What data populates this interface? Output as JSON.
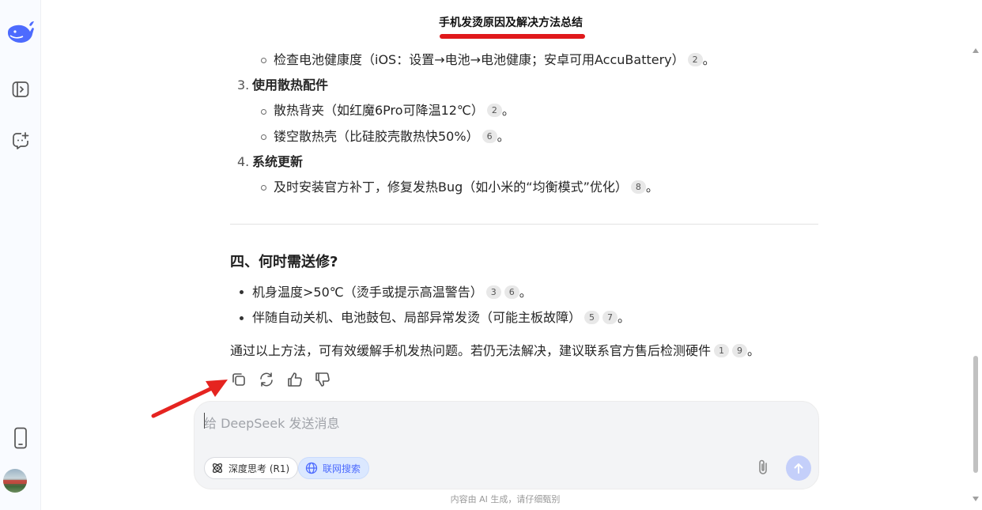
{
  "title": "手机发烫原因及解决方法总结",
  "colors": {
    "accent": "#4d6bfe",
    "underline": "#e0191b",
    "arrow": "#e52420"
  },
  "icons": {
    "logo": "deepseek-whale-icon",
    "sidebar": [
      "sidebar-toggle-icon",
      "new-chat-icon",
      "mobile-app-icon"
    ]
  },
  "content": {
    "battery_check": {
      "text": "检查电池健康度（iOS：设置→电池→电池健康；安卓可用AccuBattery）",
      "cites": [
        "2"
      ],
      "end": "。"
    },
    "item3": {
      "num": "3.",
      "label": "使用散热配件"
    },
    "item3_sub1": {
      "text": "散热背夹（如红魔6Pro可降温12℃）",
      "cites": [
        "2"
      ],
      "end": "。"
    },
    "item3_sub2": {
      "text": "镂空散热壳（比硅胶壳散热快50%）",
      "cites": [
        "6"
      ],
      "end": "。"
    },
    "item4": {
      "num": "4.",
      "label": "系统更新"
    },
    "item4_sub1": {
      "text": "及时安装官方补丁，修复发热Bug（如小米的“均衡模式”优化）",
      "cites": [
        "8"
      ],
      "end": "。"
    },
    "section_heading": "四、何时需送修?",
    "bullet1": {
      "text": "机身温度>50℃（烫手或提示高温警告）",
      "cites": [
        "3",
        "6"
      ],
      "end": "。"
    },
    "bullet2": {
      "text": "伴随自动关机、电池鼓包、局部异常发烫（可能主板故障）",
      "cites": [
        "5",
        "7"
      ],
      "end": "。"
    },
    "conclusion": {
      "text": "通过以上方法，可有效缓解手机发热问题。若仍无法解决，建议联系官方售后检测硬件",
      "cites": [
        "1",
        "9"
      ],
      "end": "。"
    }
  },
  "actions": [
    "copy-icon",
    "regenerate-icon",
    "thumbs-up-icon",
    "thumbs-down-icon"
  ],
  "composer": {
    "placeholder": "给 DeepSeek 发送消息",
    "deep_think_label": "深度思考 (R1)",
    "web_search_label": "联网搜索"
  },
  "footer_note": "内容由 AI 生成，请仔细甄别"
}
